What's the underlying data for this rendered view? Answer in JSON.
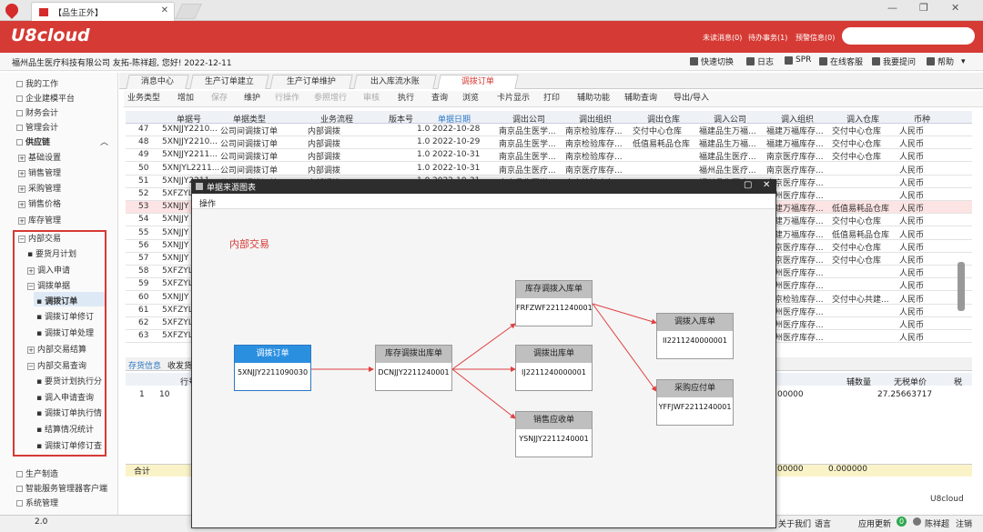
{
  "window": {
    "tab_title": "【品生正外】"
  },
  "header": {
    "brand": "U8cloud",
    "unread": "未读消息(0)",
    "todo": "待办事务(1)",
    "alert": "预警信息(0)"
  },
  "company_bar": {
    "text": "福州品生医疗科技有限公司 友拓-陈祥超, 您好! 2022-12-11",
    "tools": [
      "快速切换",
      "日志",
      "SPR",
      "在线客服",
      "我要提问",
      "帮助"
    ]
  },
  "sidebar": {
    "top": [
      "我的工作",
      "企业建模平台",
      "财务会计",
      "管理会计",
      "供应链"
    ],
    "supply": [
      "基础设置",
      "销售管理",
      "采购管理",
      "销售价格",
      "库存管理"
    ],
    "internal": {
      "label": "内部交易",
      "items": [
        "要货月计划",
        "调入申请",
        "调拨单据",
        "调拨订单",
        "调拨订单修订",
        "调拨订单处理",
        "内部交易结算",
        "内部交易查询",
        "要货计划执行分",
        "调入申请查询",
        "调拨订单执行情",
        "结算情况统计",
        "调拨订单修订查"
      ]
    },
    "bottom": [
      "生产制造",
      "智能服务管理器客户端",
      "系统管理"
    ]
  },
  "page_tabs": [
    "消息中心",
    "生产订单建立",
    "生产订单维护",
    "出入库流水账",
    "调拨订单"
  ],
  "toolbar": [
    "业务类型",
    "增加",
    "保存",
    "维护",
    "行操作",
    "参照增行",
    "审核",
    "执行",
    "查询",
    "浏览",
    "卡片显示",
    "打印",
    "辅助功能",
    "辅助查询",
    "导出/导入"
  ],
  "toolbar_disabled": [
    2,
    4,
    5,
    6
  ],
  "table": {
    "headers": [
      "单据号",
      "单据类型",
      "业务流程",
      "版本号",
      "单据日期",
      "调出公司",
      "调出组织",
      "调出仓库",
      "调入公司",
      "调入组织",
      "调入仓库",
      "币种"
    ],
    "rows": [
      {
        "n": "47",
        "no": "5XNJJY2210...",
        "type": "公司间调拨订单",
        "flow": "内部调拨",
        "ver": "1.0",
        "date": "2022-10-28",
        "oc": "南京品生医学...",
        "oo": "南京检验库存...",
        "ow": "交付中心仓库",
        "ic": "福建品生万福...",
        "io": "福建万福库存...",
        "iw": "交付中心仓库",
        "cur": "人民币"
      },
      {
        "n": "48",
        "no": "5XNJJY2210...",
        "type": "公司间调拨订单",
        "flow": "内部调拨",
        "ver": "1.0",
        "date": "2022-10-29",
        "oc": "南京品生医学...",
        "oo": "南京检验库存...",
        "ow": "低值易耗品仓库",
        "ic": "福建品生万福...",
        "io": "福建万福库存...",
        "iw": "交付中心仓库",
        "cur": "人民币"
      },
      {
        "n": "49",
        "no": "5XNJJY2211...",
        "type": "公司间调拨订单",
        "flow": "内部调拨",
        "ver": "1.0",
        "date": "2022-10-31",
        "oc": "南京品生医学...",
        "oo": "南京检验库存...",
        "ow": "",
        "ic": "福建品生医疗...",
        "io": "南京医疗库存...",
        "iw": "交付中心仓库",
        "cur": "人民币"
      },
      {
        "n": "50",
        "no": "5XNJYL2211...",
        "type": "公司间调拨订单",
        "flow": "内部调拨",
        "ver": "1.0",
        "date": "2022-10-31",
        "oc": "南京品生医疗...",
        "oo": "南京医疗库存...",
        "ow": "",
        "ic": "福州品生医疗...",
        "io": "南京医疗库存...",
        "iw": "",
        "cur": "人民币"
      },
      {
        "n": "51",
        "no": "5XNJJY2211...",
        "type": "公司间调拨订单",
        "flow": "内部调拨",
        "ver": "1.0",
        "date": "2022-10-31",
        "oc": "南京品生医学...",
        "oo": "南京检验库存...",
        "ow": "",
        "ic": "福州品生医疗...",
        "io": "南京医疗库存...",
        "iw": "",
        "cur": "人民币"
      },
      {
        "n": "52",
        "no": "5XFZYL",
        "type": "",
        "flow": "",
        "ver": "",
        "date": "",
        "oc": "",
        "oo": "",
        "ow": "",
        "ic": "",
        "io": "福州医疗库存...",
        "iw": "",
        "cur": "人民币"
      },
      {
        "n": "53",
        "no": "5XNJJY",
        "type": "",
        "flow": "",
        "ver": "",
        "date": "",
        "oc": "",
        "oo": "",
        "ow": "",
        "ic": "",
        "io": "福建万福库存...",
        "iw": "低值易耗品仓库",
        "cur": "人民币"
      },
      {
        "n": "54",
        "no": "5XNJJY",
        "type": "",
        "flow": "",
        "ver": "",
        "date": "",
        "oc": "",
        "oo": "",
        "ow": "",
        "ic": "",
        "io": "福建万福库存...",
        "iw": "交付中心仓库",
        "cur": "人民币"
      },
      {
        "n": "55",
        "no": "5XNJJY",
        "type": "",
        "flow": "",
        "ver": "",
        "date": "",
        "oc": "",
        "oo": "",
        "ow": "",
        "ic": "",
        "io": "福建万福库存...",
        "iw": "低值易耗品仓库",
        "cur": "人民币"
      },
      {
        "n": "56",
        "no": "5XNJJY",
        "type": "",
        "flow": "",
        "ver": "",
        "date": "",
        "oc": "",
        "oo": "",
        "ow": "",
        "ic": "",
        "io": "南京医疗库存...",
        "iw": "交付中心仓库",
        "cur": "人民币"
      },
      {
        "n": "57",
        "no": "5XNJJY",
        "type": "",
        "flow": "",
        "ver": "",
        "date": "",
        "oc": "",
        "oo": "",
        "ow": "",
        "ic": "",
        "io": "南京医疗库存...",
        "iw": "交付中心仓库",
        "cur": "人民币"
      },
      {
        "n": "58",
        "no": "5XFZYL",
        "type": "",
        "flow": "",
        "ver": "",
        "date": "",
        "oc": "",
        "oo": "",
        "ow": "",
        "ic": "",
        "io": "福州医疗库存...",
        "iw": "",
        "cur": "人民币"
      },
      {
        "n": "59",
        "no": "5XFZYL",
        "type": "",
        "flow": "",
        "ver": "",
        "date": "",
        "oc": "",
        "oo": "",
        "ow": "",
        "ic": "",
        "io": "福州医疗库存...",
        "iw": "",
        "cur": "人民币"
      },
      {
        "n": "60",
        "no": "5XNJJY",
        "type": "",
        "flow": "",
        "ver": "",
        "date": "",
        "oc": "",
        "oo": "",
        "ow": "",
        "ic": "",
        "io": "南京检验库存...",
        "iw": "交付中心共建...",
        "cur": "人民币"
      },
      {
        "n": "61",
        "no": "5XFZYL",
        "type": "",
        "flow": "",
        "ver": "",
        "date": "",
        "oc": "",
        "oo": "",
        "ow": "",
        "ic": "",
        "io": "福州医疗库存...",
        "iw": "",
        "cur": "人民币"
      },
      {
        "n": "62",
        "no": "5XFZYL",
        "type": "",
        "flow": "",
        "ver": "",
        "date": "",
        "oc": "",
        "oo": "",
        "ow": "",
        "ic": "",
        "io": "福州医疗库存...",
        "iw": "",
        "cur": "人民币"
      },
      {
        "n": "63",
        "no": "5XFZYL",
        "type": "",
        "flow": "",
        "ver": "",
        "date": "",
        "oc": "",
        "oo": "",
        "ow": "",
        "ic": "",
        "io": "福州医疗库存...",
        "iw": "",
        "cur": "人民币"
      }
    ]
  },
  "lower": {
    "tabs": [
      "存货信息",
      "收发货"
    ],
    "row_no": "行号",
    "qty_col": "辅数量",
    "price_col": "无税单价",
    "tax_col": "税",
    "row1": {
      "n": "1",
      "line": "10",
      "qty": "00000",
      "price": "27.25663717"
    },
    "sum_label": "合计",
    "sum_qty": "00000",
    "sum_price": "0.000000",
    "footer": "U8cloud"
  },
  "statusbar": {
    "version": "2.0",
    "about": "关于我们",
    "lang": "语言",
    "update": "应用更新",
    "badge": "0",
    "user": "陈祥超",
    "logout": "注销"
  },
  "dialog": {
    "title": "单据来源图表",
    "menu": "操作",
    "section": "内部交易",
    "nodes": [
      {
        "title": "调拨订单",
        "code": "5XNJJY2211090030"
      },
      {
        "title": "库存调拨出库单",
        "code": "DCNJJY2211240001"
      },
      {
        "title": "库存调拨入库单",
        "code": "FRFZWF2211240001"
      },
      {
        "title": "调拨出库单",
        "code": "IJ2211240000001"
      },
      {
        "title": "销售应收单",
        "code": "YSNJJY2211240001"
      },
      {
        "title": "调拨入库单",
        "code": "II2211240000001"
      },
      {
        "title": "采购应付单",
        "code": "YFFJWF2211240001"
      }
    ]
  },
  "colors": {
    "brand": "#d63a34",
    "node_active": "#2b8fe0",
    "edge": "#e04040"
  }
}
